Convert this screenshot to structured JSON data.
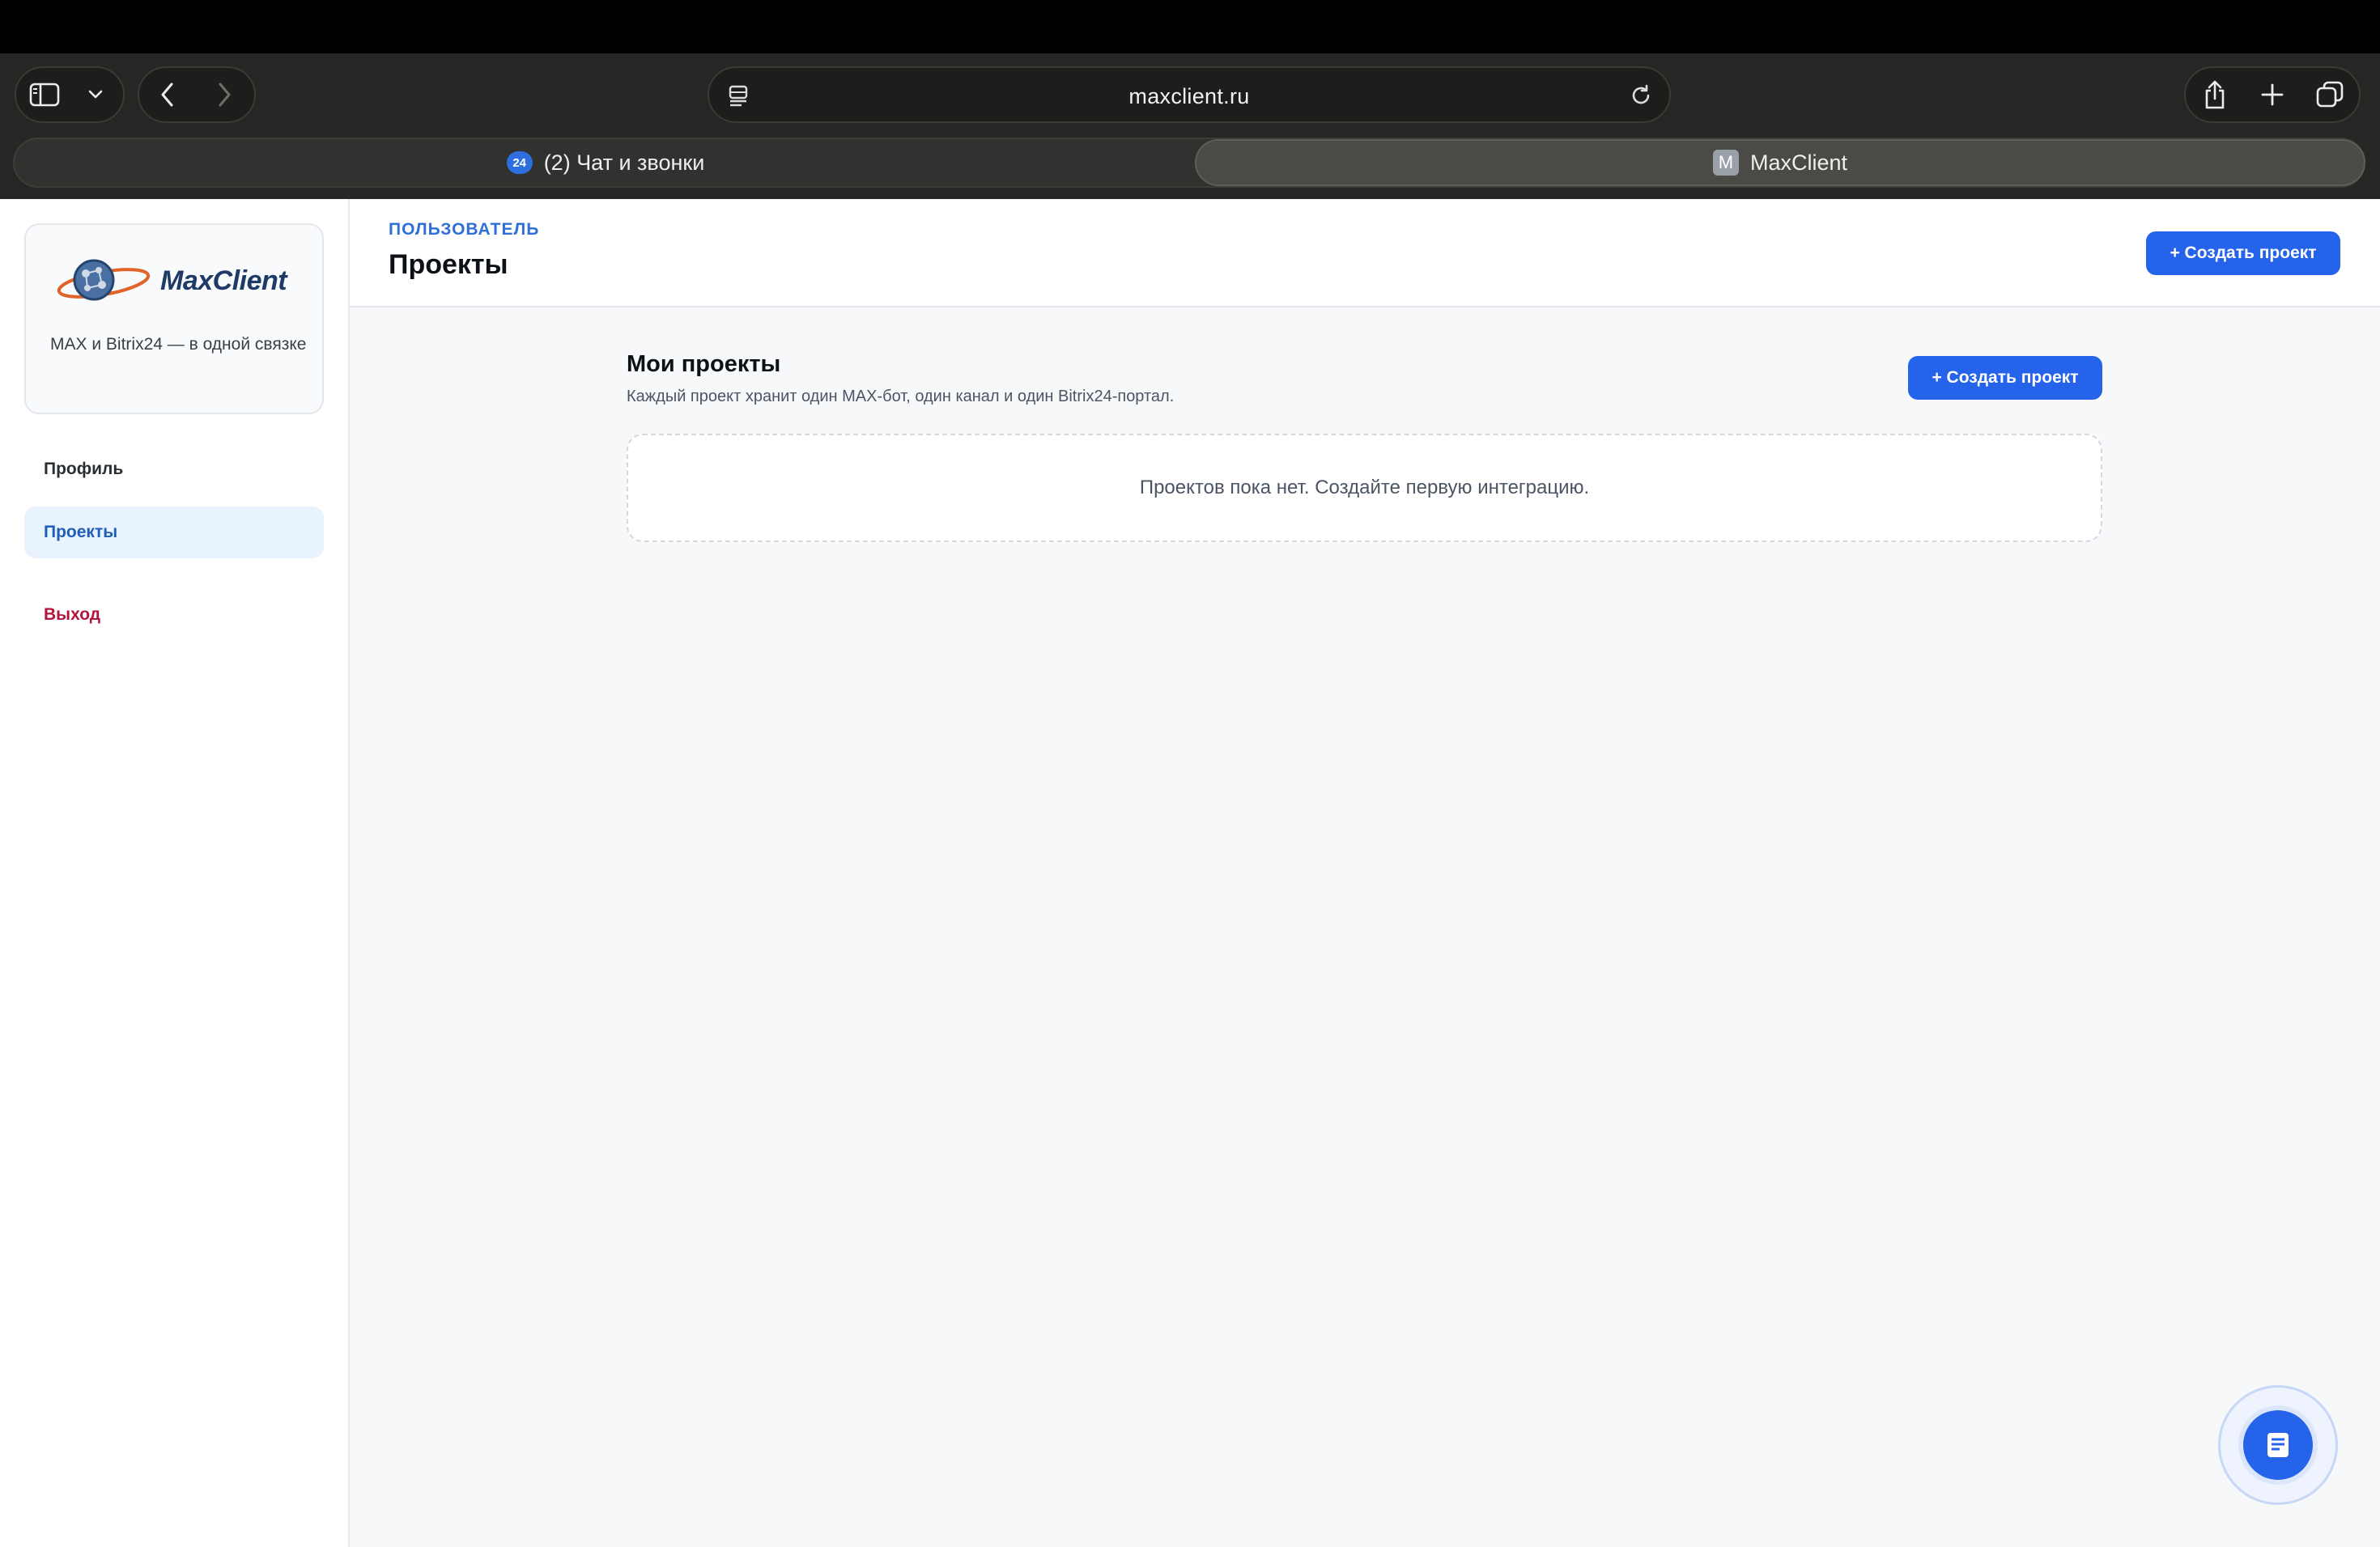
{
  "browser": {
    "url": "maxclient.ru",
    "tabs": [
      {
        "favicon_text": "24",
        "title": "(2) Чат и звонки"
      },
      {
        "favicon_text": "M",
        "title": "MaxClient"
      }
    ]
  },
  "sidebar": {
    "brand": {
      "name": "MaxClient",
      "tagline": "MAX и Bitrix24 — в одной связке"
    },
    "items": [
      {
        "label": "Профиль"
      },
      {
        "label": "Проекты"
      },
      {
        "label": "Выход"
      }
    ]
  },
  "header": {
    "eyebrow": "ПОЛЬЗОВАТЕЛЬ",
    "title": "Проекты",
    "create_button": "+ Создать проект"
  },
  "projects": {
    "title": "Мои проекты",
    "subtitle": "Каждый проект хранит один MAX-бот, один канал и один Bitrix24-портал.",
    "create_button": "+ Создать проект",
    "empty_message": "Проектов пока нет. Создайте первую интеграцию."
  },
  "colors": {
    "accent": "#2563eb",
    "logout": "#b3163c",
    "active_nav_bg": "#e9f3fd"
  }
}
